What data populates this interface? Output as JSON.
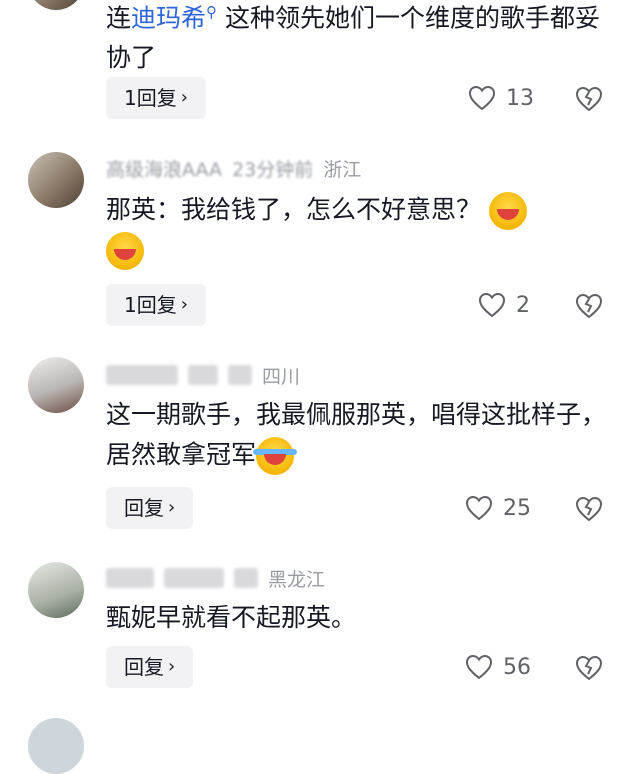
{
  "comments": [
    {
      "user": "",
      "time": "",
      "region": "",
      "text_prefix": "连",
      "mention": "迪玛希",
      "mention_icon": "search-icon",
      "text_rest": "这种领先她们一个维度的歌手都妥协了",
      "reply_label": "1回复",
      "likes": "13"
    },
    {
      "user": "高级海浪AAA",
      "time": "23分钟前",
      "region": "浙江",
      "text": "那英：我给钱了，怎么不好意思？",
      "emoji": [
        "grinning-squint-emoji",
        "grinning-squint-emoji"
      ],
      "reply_label": "1回复",
      "likes": "2"
    },
    {
      "user": "",
      "time": "",
      "region": "四川",
      "text": "这一期歌手，我最佩服那英，唱得这批样子，居然敢拿冠军",
      "emoji": [
        "crying-laughing-emoji"
      ],
      "reply_label": "回复",
      "likes": "25"
    },
    {
      "user": "",
      "time": "",
      "region": "黑龙江",
      "text": "甄妮早就看不起那英。",
      "reply_label": "回复",
      "likes": "56"
    }
  ],
  "colors": {
    "link": "#2e66d8",
    "meta": "#9a9ca3",
    "button_bg": "#f2f2f4"
  }
}
